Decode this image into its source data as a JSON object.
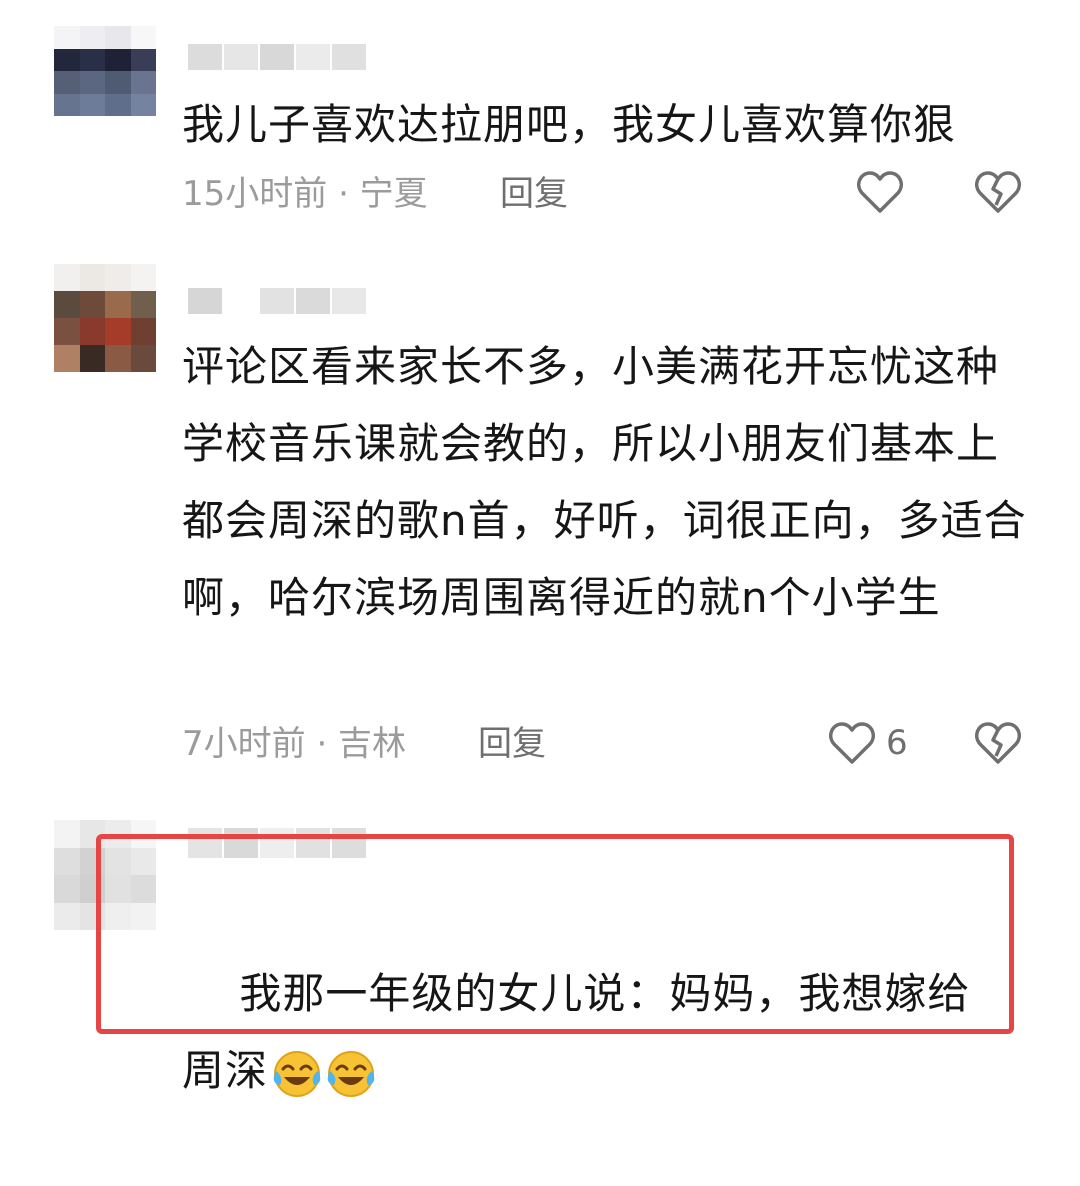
{
  "comments": [
    {
      "text": "我儿子喜欢达拉朋吧，我女儿喜欢算你狠",
      "time_location": "15小时前 · 宁夏",
      "reply_label": "回复",
      "like_count": "",
      "avatar_colors": [
        "#f4f4f6",
        "#eeeef2",
        "#e8e8ec",
        "#f7f7f8",
        "#22273b",
        "#2a2f48",
        "#1f2236",
        "#3a3d56",
        "#556077",
        "#5b6680",
        "#4f5a73",
        "#6a7390",
        "#66748f",
        "#6d7c98",
        "#5f6f8b",
        "#7583a0"
      ],
      "name_blur_colors": [
        "#dcdcdc",
        "#e6e6e6",
        "#d8d8d8",
        "#ebebeb",
        "#e0e0e0"
      ]
    },
    {
      "text": "评论区看来家长不多，小美满花开忘忧这种学校音乐课就会教的，所以小朋友们基本上都会周深的歌n首，好听，词很正向，多适合啊，哈尔滨场周围离得近的就n个小学生",
      "time_location": "7小时前 · 吉林",
      "reply_label": "回复",
      "like_count": "6",
      "avatar_colors": [
        "#f2f0ee",
        "#ece8e4",
        "#efece9",
        "#f5f3f1",
        "#5a4b3e",
        "#6e4a3a",
        "#9a6a4c",
        "#705f4c",
        "#7a5040",
        "#8a3a2c",
        "#a53c2a",
        "#6f4032",
        "#b08064",
        "#3a2a24",
        "#8a5a44",
        "#6a4a3c"
      ],
      "name_blur_colors": [
        "#d6d6d6",
        "#ffffff",
        "#e2e2e2",
        "#dadada",
        "#e8e8e8"
      ]
    },
    {
      "text": "我那一年级的女儿说：妈妈，我想嫁给周深",
      "time_location": "",
      "reply_label": "",
      "like_count": "",
      "avatar_colors": [
        "#f3f3f3",
        "#e7e7e7",
        "#ececec",
        "#f6f6f6",
        "#dedede",
        "#d2d2d2",
        "#e3e3e3",
        "#e9e9e9",
        "#d9d9d9",
        "#cfcfcf",
        "#e1e1e1",
        "#dcdcdc",
        "#ebebeb",
        "#e4e4e4",
        "#efefef",
        "#f2f2f2"
      ],
      "name_blur_colors": [
        "#e4e4e4",
        "#d9d9d9",
        "#eeeeee",
        "#e1e1e1",
        "#dddddd"
      ]
    }
  ],
  "icons": {
    "like": "heart-outline-icon",
    "dislike": "broken-heart-icon",
    "emoji": "tears-of-joy-emoji"
  },
  "colors": {
    "highlight_border": "#e64545",
    "meta_text": "#9b9b9b",
    "icon_stroke": "#6f6f6f"
  }
}
